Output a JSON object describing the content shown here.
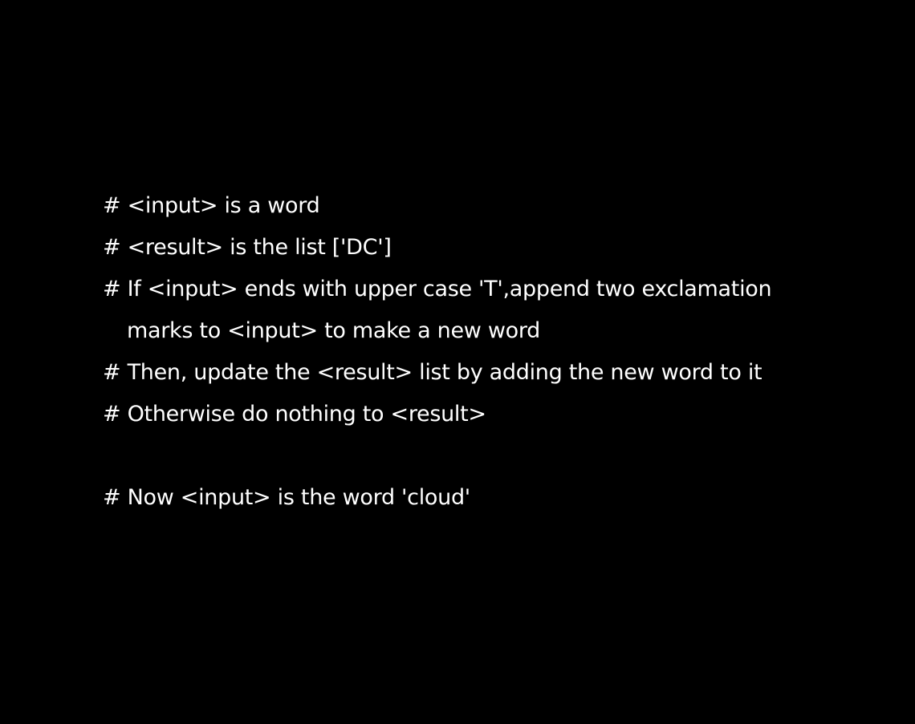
{
  "page": {
    "background_color": "#000000",
    "text_color": "#ffffff"
  },
  "lines": [
    "# <input> is a word",
    "# <result> is the list ['DC']",
    "# If <input> ends with upper case 'T',append two exclamation",
    "marks to <input> to make a new word",
    "# Then, update the <result> list by adding the new word to it",
    "# Otherwise do nothing to <result>",
    "",
    "# Now <input> is the word 'cloud'"
  ]
}
